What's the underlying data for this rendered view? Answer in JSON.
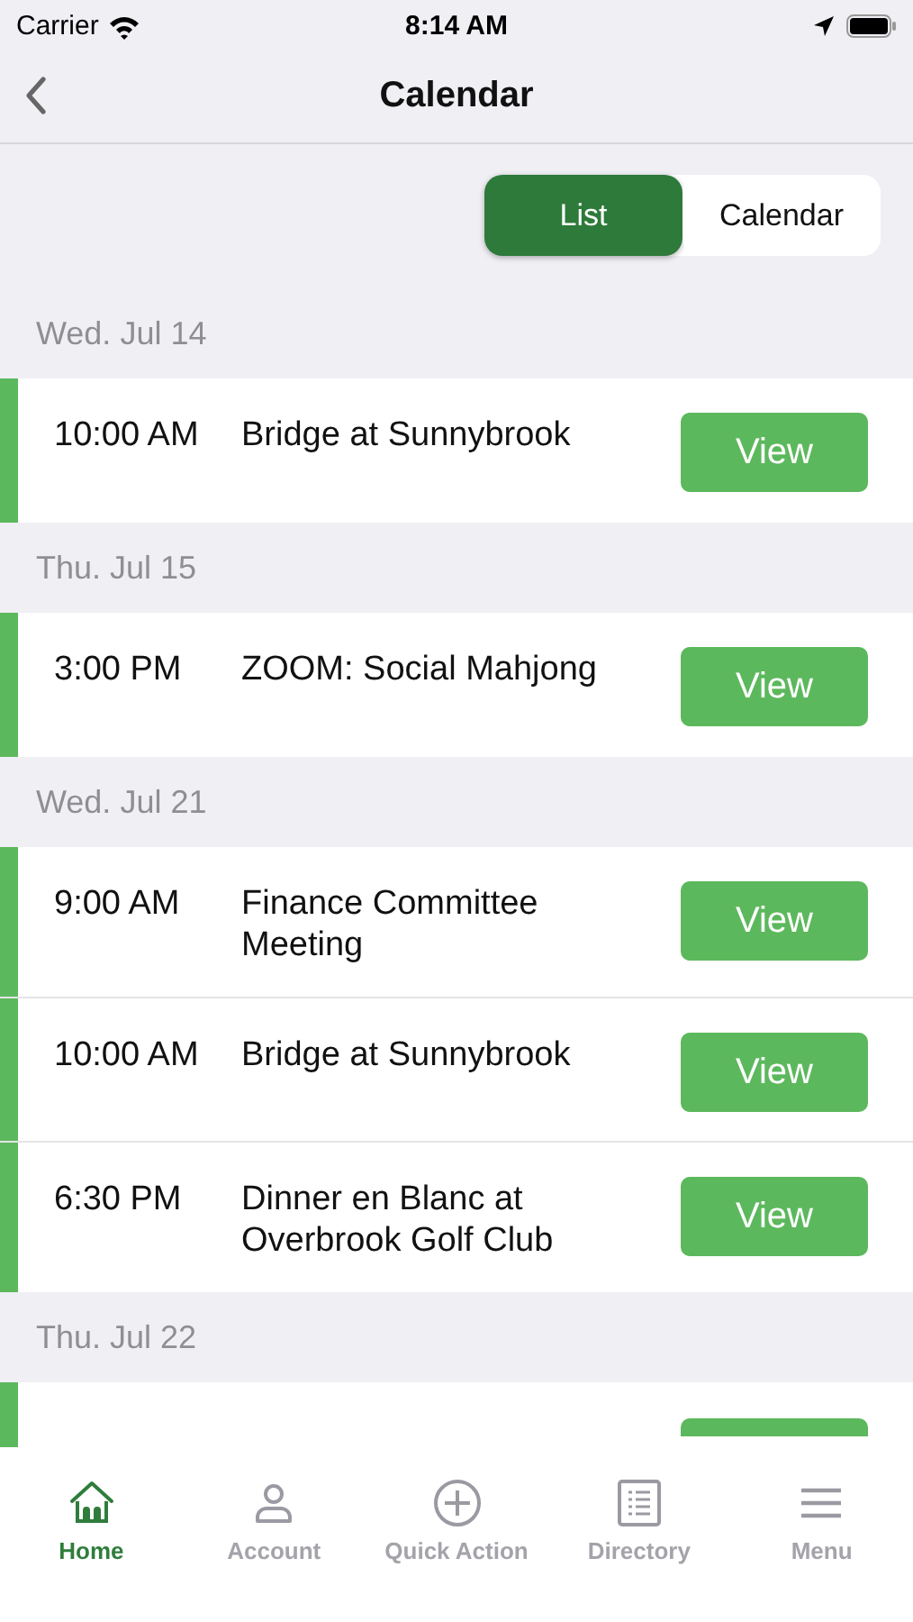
{
  "status_bar": {
    "carrier": "Carrier",
    "time": "8:14 AM"
  },
  "nav": {
    "title": "Calendar"
  },
  "view_toggle": [
    {
      "label": "List",
      "selected": true
    },
    {
      "label": "Calendar",
      "selected": false
    }
  ],
  "days": [
    {
      "date": "Wed. Jul 14",
      "events": [
        {
          "kind": "full",
          "time": "10:00 AM",
          "title": "Bridge at Sunnybrook",
          "button": "View"
        }
      ]
    },
    {
      "date": "Thu. Jul 15",
      "events": [
        {
          "kind": "full",
          "time": "3:00 PM",
          "title": "ZOOM: Social Mahjong",
          "button": "View"
        }
      ]
    },
    {
      "date": "Wed. Jul 21",
      "events": [
        {
          "kind": "full",
          "time": "9:00 AM",
          "title": "Finance Committee Meeting",
          "button": "View"
        },
        {
          "kind": "full",
          "time": "10:00 AM",
          "title": "Bridge at Sunnybrook",
          "button": "View"
        },
        {
          "kind": "full",
          "time": "6:30 PM",
          "title": "Dinner en Blanc at Overbrook Golf Club",
          "button": "View"
        }
      ]
    },
    {
      "date": "Thu. Jul 22",
      "events": [
        {
          "kind": "partial"
        }
      ]
    }
  ],
  "tab_bar": [
    {
      "label": "Home",
      "selected": true
    },
    {
      "label": "Account",
      "selected": false
    },
    {
      "label": "Quick Action",
      "selected": false
    },
    {
      "label": "Directory",
      "selected": false
    },
    {
      "label": "Menu",
      "selected": false
    }
  ]
}
